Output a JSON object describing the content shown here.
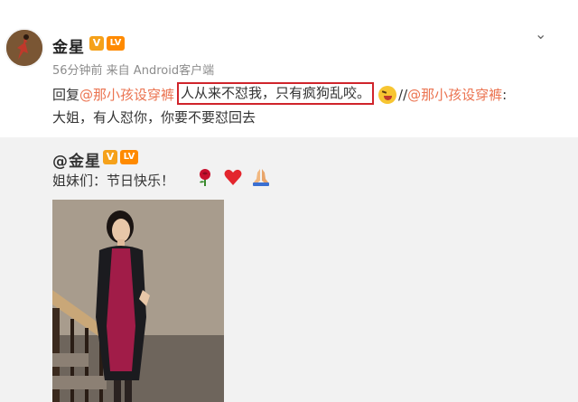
{
  "post": {
    "username": "金星",
    "badge_v": "V",
    "badge_level": "LV",
    "meta": "56分钟前 来自 Android客户端",
    "reply_prefix": "回复",
    "mention": "@那小孩设穿裤",
    "quote": "人从来不怼我，只有疯狗乱咬。",
    "forward_sep": "//",
    "forward_mention": "@那小孩设穿裤",
    "forward_colon": ":",
    "forward_text": "大姐，有人怼你，你要不要怼回去"
  },
  "repost": {
    "username": "@金星",
    "badge_v": "V",
    "badge_level": "LV",
    "text": "姐妹们：节日快乐！",
    "emojis": [
      "rose-icon",
      "heart-icon",
      "praying-hands-icon"
    ]
  },
  "colors": {
    "mention": "#eb7350",
    "highlight_border": "#d0242b",
    "repost_bg": "#f2f2f2",
    "badge": "#f5a11a"
  }
}
